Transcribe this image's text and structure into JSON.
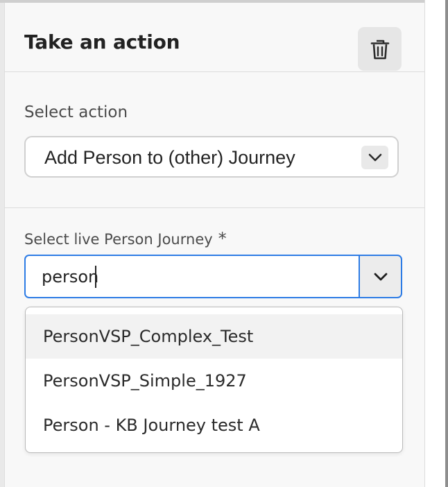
{
  "panel": {
    "title": "Take an action"
  },
  "action": {
    "label": "Select action",
    "selected": "Add Person to (other) Journey"
  },
  "journey": {
    "label": "Select live Person Journey",
    "required_marker": "*",
    "input_value": "person",
    "options": [
      {
        "label": "PersonVSP_Complex_Test",
        "highlighted": true
      },
      {
        "label": "PersonVSP_Simple_1927",
        "highlighted": false
      },
      {
        "label": "Person - KB Journey test A",
        "highlighted": false
      }
    ]
  },
  "icons": {
    "delete": "trash-icon",
    "action_chevron": "chevron-down-icon",
    "journey_chevron": "chevron-down-icon"
  },
  "colors": {
    "focus_blue": "#2c7be5",
    "text": "#222222",
    "label": "#4b4b4b"
  }
}
